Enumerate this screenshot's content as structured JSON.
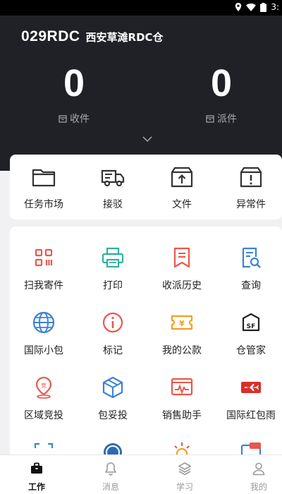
{
  "status_bar": {
    "time": "3:"
  },
  "header": {
    "site_code": "029RDC",
    "site_name": "西安草滩RDC仓",
    "stats": [
      {
        "value": "0",
        "label": "收件"
      },
      {
        "value": "0",
        "label": "派件"
      }
    ]
  },
  "quick_actions": [
    {
      "label": "任务市场",
      "icon": "folder-icon"
    },
    {
      "label": "接驳",
      "icon": "truck-icon"
    },
    {
      "label": "文件",
      "icon": "upload-box-icon"
    },
    {
      "label": "异常件",
      "icon": "alert-box-icon"
    }
  ],
  "tools": [
    {
      "label": "扫我寄件",
      "icon": "qr-code-icon",
      "color": "#e9584b"
    },
    {
      "label": "打印",
      "icon": "printer-icon",
      "color": "#2fb39a"
    },
    {
      "label": "收派历史",
      "icon": "bookmark-doc-icon",
      "color": "#e9584b"
    },
    {
      "label": "查询",
      "icon": "search-doc-icon",
      "color": "#3b82d6"
    },
    {
      "label": "国际小包",
      "icon": "globe-icon",
      "color": "#3b82d6"
    },
    {
      "label": "标记",
      "icon": "info-circle-icon",
      "color": "#e9584b"
    },
    {
      "label": "我的公款",
      "icon": "yen-ticket-icon",
      "color": "#f0a020"
    },
    {
      "label": "仓管家",
      "icon": "sf-warehouse-icon",
      "color": "#222222"
    },
    {
      "label": "区域竞投",
      "icon": "bid-pin-icon",
      "color": "#e9584b"
    },
    {
      "label": "包妥投",
      "icon": "package-icon",
      "color": "#3b82d6"
    },
    {
      "label": "销售助手",
      "icon": "monitor-chart-icon",
      "color": "#e9584b"
    },
    {
      "label": "国际红包雨",
      "icon": "airplane-icon",
      "color": "#d8302a"
    }
  ],
  "tabs": [
    {
      "label": "工作",
      "icon": "briefcase-icon",
      "active": true
    },
    {
      "label": "消息",
      "icon": "bell-icon",
      "active": false
    },
    {
      "label": "学习",
      "icon": "layers-icon",
      "active": false
    },
    {
      "label": "我的",
      "icon": "person-icon",
      "active": false
    }
  ]
}
